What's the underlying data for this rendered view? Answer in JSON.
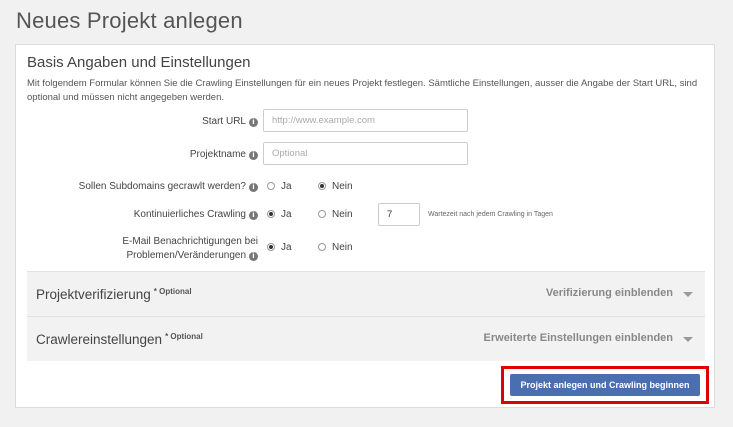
{
  "page": {
    "title": "Neues Projekt anlegen"
  },
  "basis": {
    "title": "Basis Angaben und Einstellungen",
    "intro": "Mit folgendem Formular können Sie die Crawling Einstellungen für ein neues Projekt festlegen. Sämtliche Einstellungen, ausser die Angabe der Start URL, sind optional und müssen nicht angegeben werden."
  },
  "form": {
    "start_url": {
      "label": "Start URL",
      "placeholder": "http://www.example.com",
      "value": ""
    },
    "projektname": {
      "label": "Projektname",
      "placeholder": "Optional",
      "value": ""
    },
    "subdomains": {
      "label": "Sollen Subdomains gecrawlt werden?",
      "option_ja": "Ja",
      "option_nein": "Nein",
      "selected": "Nein"
    },
    "kontinuierlich": {
      "label": "Kontinuierliches Crawling",
      "option_ja": "Ja",
      "option_nein": "Nein",
      "selected": "Ja",
      "wartezeit_value": "7",
      "wartezeit_hint": "Wartezeit nach jedem Crawling in Tagen"
    },
    "email": {
      "label_line1": "E-Mail Benachrichtigungen bei",
      "label_line2": "Problemen/Veränderungen",
      "option_ja": "Ja",
      "option_nein": "Nein",
      "selected": "Ja"
    }
  },
  "sections": {
    "verifizierung": {
      "title": "Projektverifizierung",
      "optional": "* Optional",
      "toggle": "Verifizierung einblenden"
    },
    "crawler": {
      "title": "Crawlereinstellungen",
      "optional": "* Optional",
      "toggle": "Erweiterte Einstellungen einblenden"
    }
  },
  "actions": {
    "submit_label": "Projekt anlegen und Crawling beginnen"
  },
  "colors": {
    "primary_button": "#4a6eb0",
    "highlight": "#e00000"
  },
  "icons": {
    "info": "info-icon",
    "toggle": "chevron-down-icon"
  }
}
